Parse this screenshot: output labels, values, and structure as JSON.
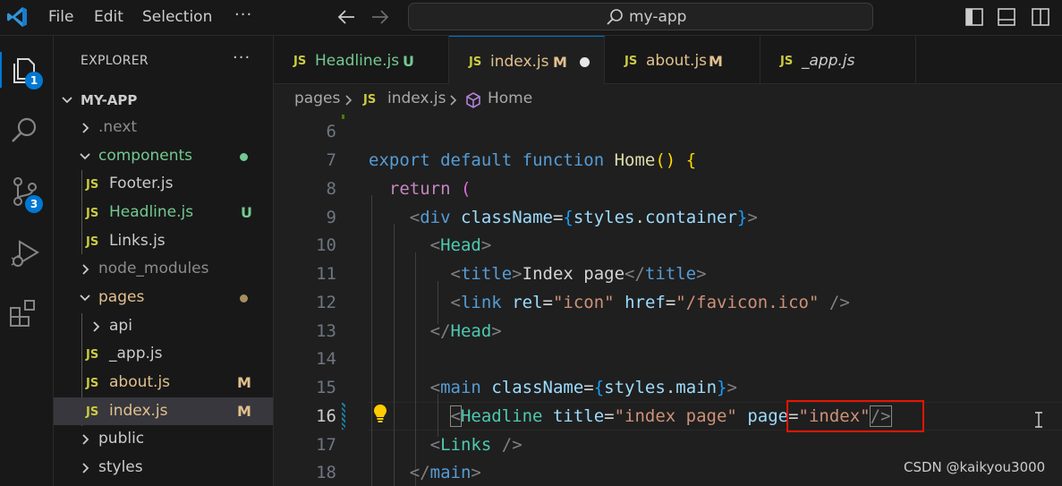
{
  "titlebar": {
    "menus": [
      "File",
      "Edit",
      "Selection"
    ],
    "more": "···",
    "search_text": "my-app"
  },
  "activity": {
    "explorer_badge": "1",
    "scm_badge": "3"
  },
  "sidebar": {
    "title": "EXPLORER",
    "more": "···",
    "root": "MY-APP",
    "items": [
      {
        "label": "next",
        "prefix": ".",
        "kind": "folder",
        "open": false
      },
      {
        "label": "components",
        "kind": "folder",
        "open": true,
        "status": "dot"
      },
      {
        "label": "Footer.js",
        "kind": "file"
      },
      {
        "label": "Headline.js",
        "kind": "file",
        "status": "U"
      },
      {
        "label": "Links.js",
        "kind": "file"
      },
      {
        "label": "node_modules",
        "kind": "folder",
        "open": false
      },
      {
        "label": "pages",
        "kind": "folder",
        "open": true,
        "status": "dot"
      },
      {
        "label": "api",
        "kind": "folder",
        "open": false
      },
      {
        "label": "_app.js",
        "kind": "file"
      },
      {
        "label": "about.js",
        "kind": "file",
        "status": "M"
      },
      {
        "label": "index.js",
        "kind": "file",
        "status": "M",
        "selected": true
      },
      {
        "label": "public",
        "kind": "folder",
        "open": false
      },
      {
        "label": "styles",
        "kind": "folder",
        "open": false
      }
    ],
    "file_icon_text": "JS"
  },
  "tabs": [
    {
      "label": "Headline.js",
      "status": "U"
    },
    {
      "label": "index.js",
      "status": "M",
      "active": true,
      "dirty": true
    },
    {
      "label": "about.js",
      "status": "M"
    },
    {
      "label": "_app.js"
    }
  ],
  "breadcrumb": {
    "folder": "pages",
    "file": "index.js",
    "symbol": "Home"
  },
  "editor": {
    "line_numbers": [
      "6",
      "7",
      "8",
      "9",
      "10",
      "11",
      "12",
      "13",
      "14",
      "15",
      "16",
      "17",
      "18"
    ],
    "current_line": "16"
  },
  "watermark": "CSDN @kaikyou3000",
  "colors": {
    "accent": "#0078d4",
    "modified": "#e2c08d",
    "untracked": "#73c991",
    "highlight_box": "#e51400"
  }
}
